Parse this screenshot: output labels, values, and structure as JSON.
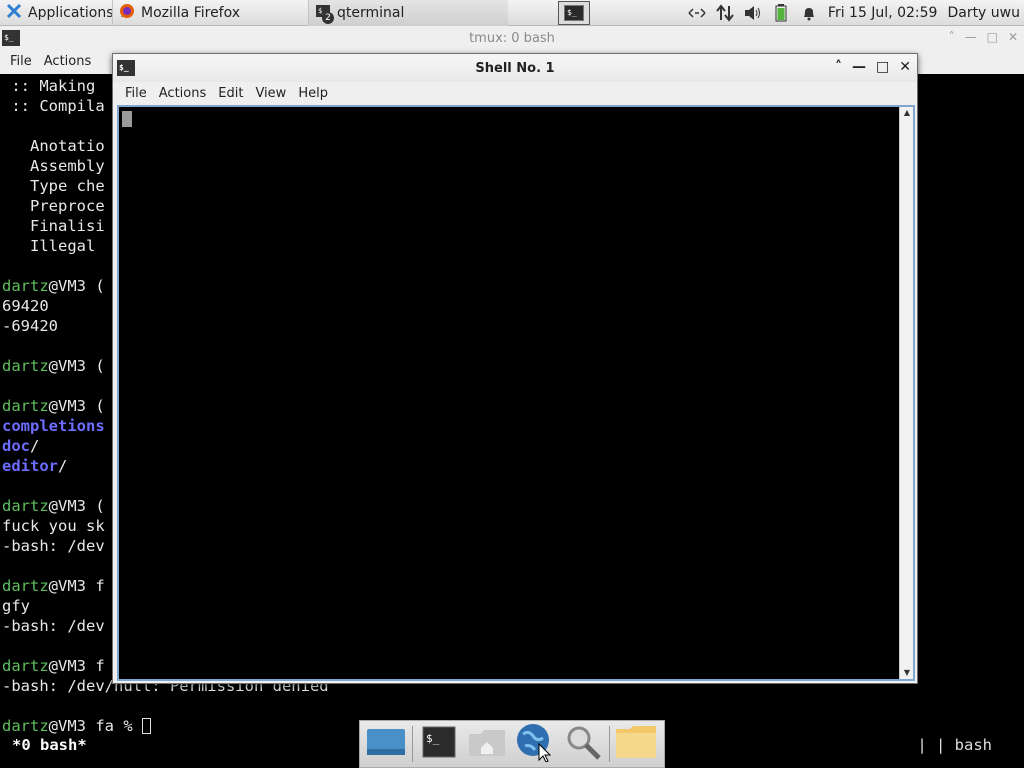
{
  "top_panel": {
    "apps_label": "Applications",
    "apps_separator": "≣",
    "firefox_label": "Mozilla Firefox",
    "qterminal_label": "qterminal",
    "qterminal_badge": "2",
    "datetime": "Fri 15 Jul, 02:59",
    "user": "Darty uwu"
  },
  "tmux_window": {
    "title": "tmux: 0 bash",
    "menu": [
      "File",
      "Actions"
    ],
    "lines": [
      {
        "t": " :: Making"
      },
      {
        "t": " :: Compila"
      },
      {
        "t": ""
      },
      {
        "t": "   Anotatio"
      },
      {
        "t": "   Assembly"
      },
      {
        "t": "   Type che"
      },
      {
        "t": "   Preproce"
      },
      {
        "t": "   Finalisi"
      },
      {
        "t": "   Illegal "
      },
      {
        "t": ""
      },
      {
        "u": "dartz",
        "t": "@VM3 ("
      },
      {
        "t": "69420"
      },
      {
        "t": "-69420"
      },
      {
        "t": ""
      },
      {
        "u": "dartz",
        "t": "@VM3 ("
      },
      {
        "t": ""
      },
      {
        "u": "dartz",
        "t": "@VM3 ("
      },
      {
        "b": "completions",
        "t": ""
      },
      {
        "b": "doc",
        "t": "/"
      },
      {
        "b": "editor",
        "t": "/"
      },
      {
        "t": ""
      },
      {
        "u": "dartz",
        "t": "@VM3 ("
      },
      {
        "t": "fuck you sk"
      },
      {
        "t": "-bash: /dev"
      },
      {
        "t": ""
      },
      {
        "u": "dartz",
        "t": "@VM3 f"
      },
      {
        "t": "gfy"
      },
      {
        "t": "-bash: /dev"
      },
      {
        "t": ""
      },
      {
        "u": "dartz",
        "t": "@VM3 f"
      },
      {
        "t": "-bash: /dev/null: Permission denied"
      },
      {
        "t": ""
      },
      {
        "u": "dartz",
        "t": "@VM3 fa % "
      }
    ],
    "status_left": "*0 bash*",
    "status_right": "|   | bash"
  },
  "shell_window": {
    "title": "Shell No. 1",
    "menu": [
      "File",
      "Actions",
      "Edit",
      "View",
      "Help"
    ]
  },
  "dock": [
    "show-desktop",
    "terminal",
    "home-folder",
    "web-browser",
    "search",
    "files"
  ]
}
